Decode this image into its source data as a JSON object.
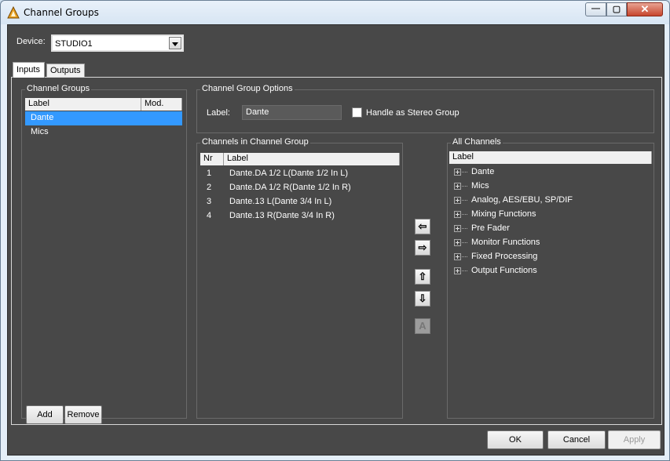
{
  "window": {
    "title": "Channel Groups",
    "min_glyph": "—",
    "max_glyph": "▢",
    "close_glyph": "✕"
  },
  "device": {
    "label": "Device:",
    "value": "STUDIO1"
  },
  "tabs": [
    {
      "label": "Inputs",
      "active": true
    },
    {
      "label": "Outputs",
      "active": false
    }
  ],
  "channel_groups": {
    "title": "Channel Groups",
    "columns": [
      "Label",
      "Mod."
    ],
    "rows": [
      {
        "label": "Dante",
        "selected": true
      },
      {
        "label": "Mics",
        "selected": false
      }
    ],
    "add_label": "Add",
    "remove_label": "Remove"
  },
  "options": {
    "title": "Channel Group Options",
    "label_caption": "Label:",
    "label_value": "Dante",
    "stereo_label": "Handle as Stereo Group",
    "stereo_checked": false
  },
  "channels_in_group": {
    "title": "Channels in Channel Group",
    "columns": [
      "Nr",
      "Label"
    ],
    "rows": [
      {
        "nr": "1",
        "label": "Dante.DA 1/2 L(Dante 1/2 In L)"
      },
      {
        "nr": "2",
        "label": "Dante.DA 1/2 R(Dante 1/2 In R)"
      },
      {
        "nr": "3",
        "label": "Dante.13 L(Dante 3/4 In L)"
      },
      {
        "nr": "4",
        "label": "Dante.13 R(Dante 3/4 In R)"
      }
    ]
  },
  "transfer_buttons": {
    "add_glyph": "⇦",
    "remove_glyph": "⇨",
    "up_glyph": "⇧",
    "down_glyph": "⇩",
    "sort_glyph": "A"
  },
  "all_channels": {
    "title": "All Channels",
    "column": "Label",
    "items": [
      "Dante",
      "Mics",
      "Analog, AES/EBU, SP/DIF",
      "Mixing Functions",
      "Pre Fader",
      "Monitor Functions",
      "Fixed Processing",
      "Output Functions"
    ]
  },
  "footer": {
    "ok": "OK",
    "cancel": "Cancel",
    "apply": "Apply",
    "apply_enabled": false
  }
}
